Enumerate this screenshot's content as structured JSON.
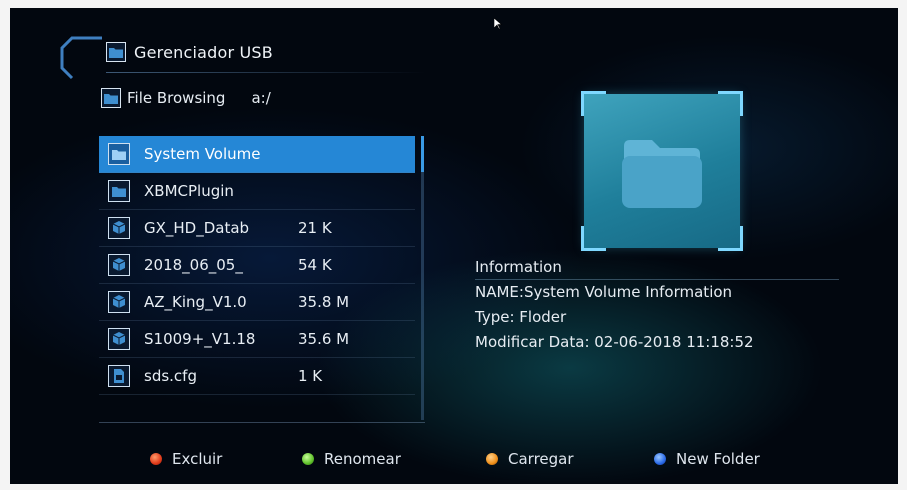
{
  "header": {
    "title": "Gerenciador USB"
  },
  "path": {
    "label": "File Browsing",
    "value": "a:/"
  },
  "files": [
    {
      "name": "System Volume",
      "size": "",
      "icon": "folder-icon",
      "selected": true
    },
    {
      "name": "XBMCPlugin",
      "size": "",
      "icon": "folder-icon",
      "selected": false
    },
    {
      "name": "GX_HD_Datab",
      "size": "21 K",
      "icon": "package-icon",
      "selected": false
    },
    {
      "name": "2018_06_05_",
      "size": "54 K",
      "icon": "package-icon",
      "selected": false
    },
    {
      "name": "AZ_King_V1.0",
      "size": "35.8 M",
      "icon": "package-icon",
      "selected": false
    },
    {
      "name": "S1009+_V1.18",
      "size": "35.6 M",
      "icon": "package-icon",
      "selected": false
    },
    {
      "name": "sds.cfg",
      "size": "1 K",
      "icon": "file-icon",
      "selected": false
    }
  ],
  "info": {
    "heading": "Information",
    "name_line": "NAME:System Volume Information",
    "type_line": "Type: Floder",
    "date_line": "Modificar Data: 02-06-2018 11:18:52"
  },
  "footer": {
    "delete": "Excluir",
    "rename": "Renomear",
    "load": "Carregar",
    "new_folder": "New Folder"
  },
  "colors": {
    "selection": "#2587d6",
    "preview": "#1f7f9b",
    "red_key": "#e03a1a",
    "green_key": "#5fc02a",
    "orange_key": "#f0901a",
    "blue_key": "#2a6ae8"
  }
}
